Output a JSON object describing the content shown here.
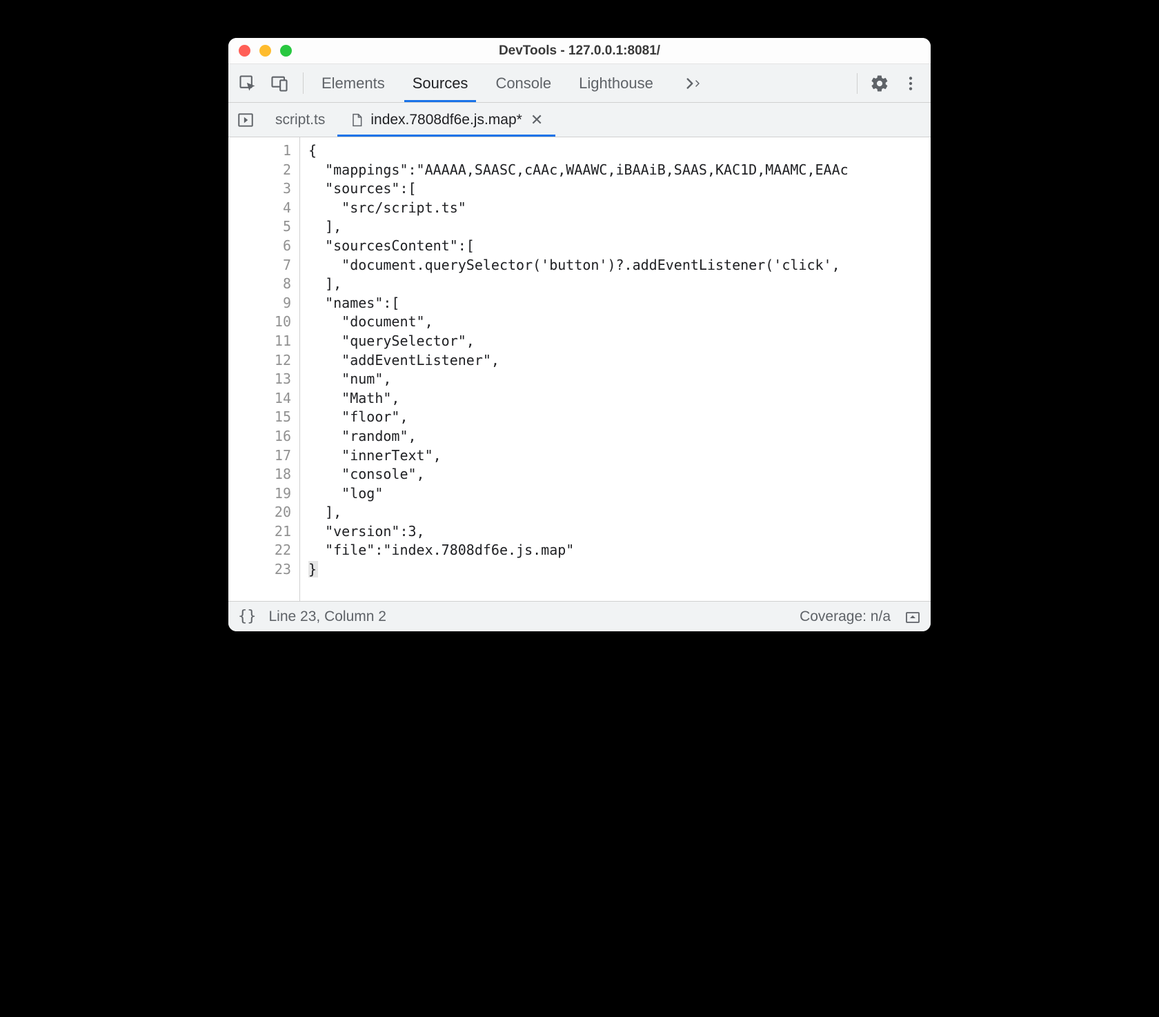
{
  "window": {
    "title": "DevTools - 127.0.0.1:8081/"
  },
  "mainTabs": {
    "elements": "Elements",
    "sources": "Sources",
    "console": "Console",
    "lighthouse": "Lighthouse"
  },
  "fileTabs": {
    "scriptTs": "script.ts",
    "indexMap": "index.7808df6e.js.map*"
  },
  "editor": {
    "lines": [
      "{",
      "  \"mappings\":\"AAAAA,SAASC,cAAc,WAAWC,iBAAiB,SAAS,KAC1D,MAAMC,EAAc",
      "  \"sources\":[",
      "    \"src/script.ts\"",
      "  ],",
      "  \"sourcesContent\":[",
      "    \"document.querySelector('button')?.addEventListener('click',",
      "  ],",
      "  \"names\":[",
      "    \"document\",",
      "    \"querySelector\",",
      "    \"addEventListener\",",
      "    \"num\",",
      "    \"Math\",",
      "    \"floor\",",
      "    \"random\",",
      "    \"innerText\",",
      "    \"console\",",
      "    \"log\"",
      "  ],",
      "  \"version\":3,",
      "  \"file\":\"index.7808df6e.js.map\"",
      "}"
    ]
  },
  "status": {
    "position": "Line 23, Column 2",
    "coverage": "Coverage: n/a"
  }
}
